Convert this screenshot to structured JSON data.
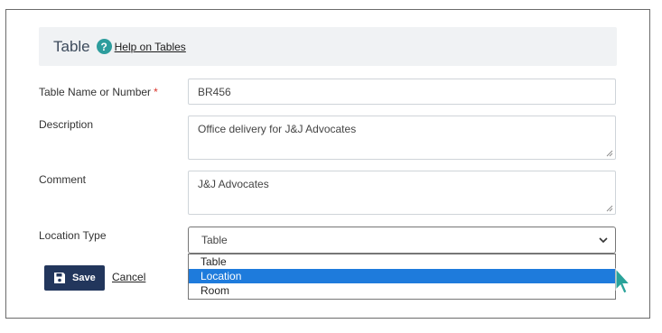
{
  "header": {
    "title": "Table",
    "help_link": "Help on Tables"
  },
  "form": {
    "name_label": "Table Name or Number",
    "name_required_mark": "*",
    "name_value": "BR456",
    "description_label": "Description",
    "description_value": "Office delivery for J&J Advocates",
    "comment_label": "Comment",
    "comment_value": "J&J Advocates",
    "location_type_label": "Location Type",
    "location_type_value": "Table",
    "location_type_options": [
      "Table",
      "Location",
      "Room"
    ],
    "highlighted_option": "Location"
  },
  "actions": {
    "save_label": "Save",
    "cancel_label": "Cancel"
  },
  "icons": {
    "help": "help-icon",
    "save": "floppy-disk-icon",
    "dropdown": "chevron-down-icon",
    "pointer": "mouse-cursor-icon"
  },
  "colors": {
    "accent": "#2d9d9d",
    "save_button": "#22365c",
    "highlight": "#1e7bdc",
    "header_bg": "#f0f2f4",
    "required": "#d9342b"
  }
}
